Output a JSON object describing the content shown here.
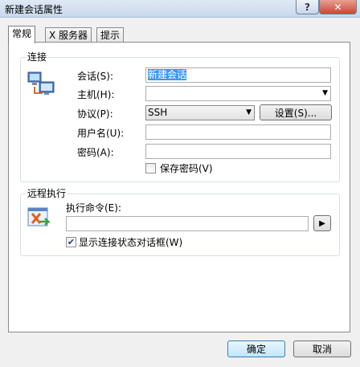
{
  "window": {
    "title": "新建会话属性",
    "help": "?",
    "close": "✕"
  },
  "tabs": [
    {
      "label": "常规"
    },
    {
      "label": "X 服务器"
    },
    {
      "label": "提示"
    }
  ],
  "connection": {
    "title": "连接",
    "session_label": "会话(S):",
    "session_value": "新建会话",
    "host_label": "主机(H):",
    "host_value": "",
    "protocol_label": "协议(P):",
    "protocol_value": "SSH",
    "settings_button": "设置(S)...",
    "username_label": "用户名(U):",
    "username_value": "",
    "password_label": "密码(A):",
    "password_value": "",
    "save_password_label": "保存密码(V)",
    "save_password_checked": false
  },
  "remote": {
    "title": "远程执行",
    "command_label": "执行命令(E):",
    "command_value": "",
    "run_glyph": "▶",
    "show_dialog_label": "显示连接状态对话框(W)",
    "show_dialog_checked": true
  },
  "footer": {
    "ok": "确定",
    "cancel": "取消"
  },
  "colors": {
    "selection": "#3399ff",
    "accent": "#3c7fb1"
  }
}
